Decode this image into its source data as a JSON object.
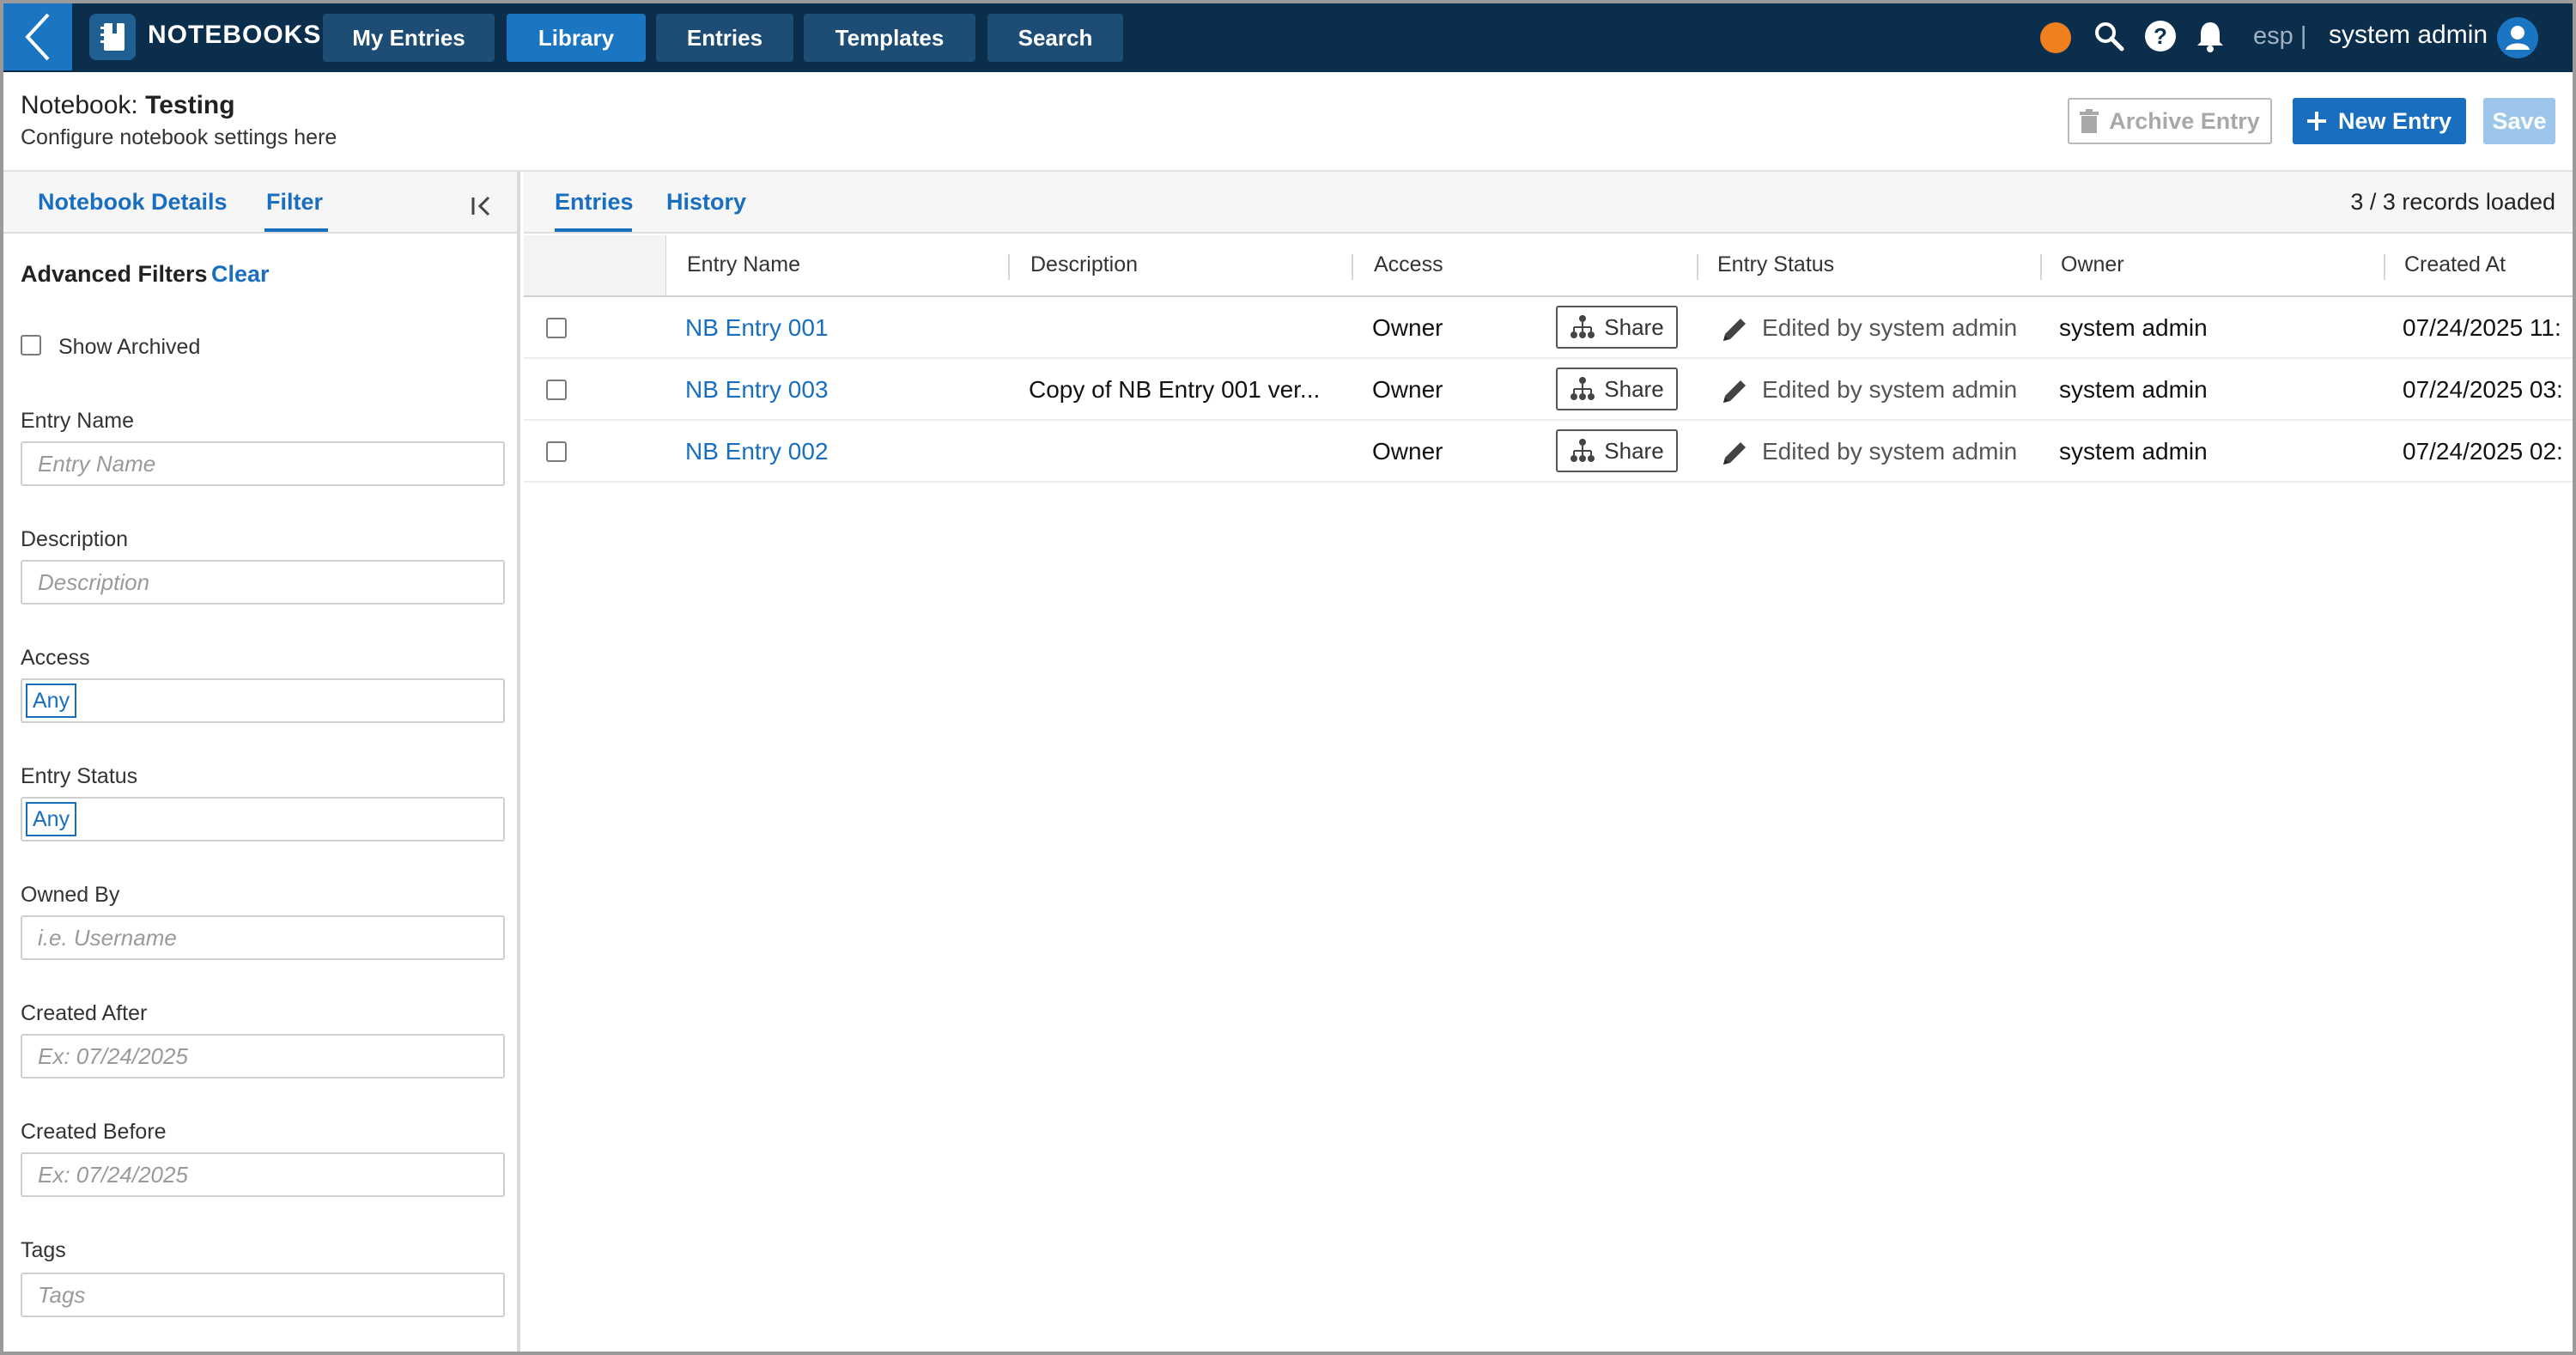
{
  "topbar": {
    "app_name": "NOTEBOOKS",
    "nav": [
      "My Entries",
      "Library",
      "Entries",
      "Templates",
      "Search"
    ],
    "active_nav": "Library",
    "lang": "esp |",
    "user": "system admin",
    "icons": [
      "back-chevron-icon",
      "notebook-logo-icon",
      "status-dot-icon",
      "search-icon",
      "help-icon",
      "bell-icon",
      "user-avatar-icon"
    ],
    "colors": {
      "bar": "#0b2e4c",
      "accent": "#1a76c2",
      "status_dot": "#f07f1f"
    }
  },
  "header": {
    "notebook_label": "Notebook:",
    "notebook_name": "Testing",
    "subtitle": "Configure notebook settings here",
    "archive_label": "Archive Entry",
    "new_label": "New Entry",
    "save_label": "Save"
  },
  "sidebar": {
    "tabs": [
      "Notebook Details",
      "Filter"
    ],
    "active_tab": "Filter",
    "advanced_title": "Advanced Filters",
    "clear_label": "Clear",
    "show_archived": "Show Archived",
    "filters": {
      "entry_name": {
        "label": "Entry Name",
        "placeholder": "Entry Name"
      },
      "description": {
        "label": "Description",
        "placeholder": "Description"
      },
      "access": {
        "label": "Access",
        "value": "Any"
      },
      "entry_status": {
        "label": "Entry Status",
        "value": "Any"
      },
      "owned_by": {
        "label": "Owned By",
        "placeholder": "i.e. Username"
      },
      "created_after": {
        "label": "Created After",
        "placeholder": "Ex: 07/24/2025"
      },
      "created_before": {
        "label": "Created Before",
        "placeholder": "Ex: 07/24/2025"
      },
      "tags": {
        "label": "Tags",
        "placeholder": "Tags"
      }
    }
  },
  "main": {
    "tabs": [
      "Entries",
      "History"
    ],
    "active_tab": "Entries",
    "records": "3 / 3 records loaded",
    "columns": [
      "Entry Name",
      "Description",
      "Access",
      "Entry Status",
      "Owner",
      "Created At"
    ],
    "share_label": "Share",
    "rows": [
      {
        "name": "NB Entry 001",
        "description": "",
        "access": "Owner",
        "status": "Edited by system admin",
        "owner": "system admin",
        "created": "07/24/2025 11:"
      },
      {
        "name": "NB Entry 003",
        "description": "Copy of NB Entry 001 ver...",
        "access": "Owner",
        "status": "Edited by system admin",
        "owner": "system admin",
        "created": "07/24/2025 03:"
      },
      {
        "name": "NB Entry 002",
        "description": "",
        "access": "Owner",
        "status": "Edited by system admin",
        "owner": "system admin",
        "created": "07/24/2025 02:"
      }
    ]
  }
}
